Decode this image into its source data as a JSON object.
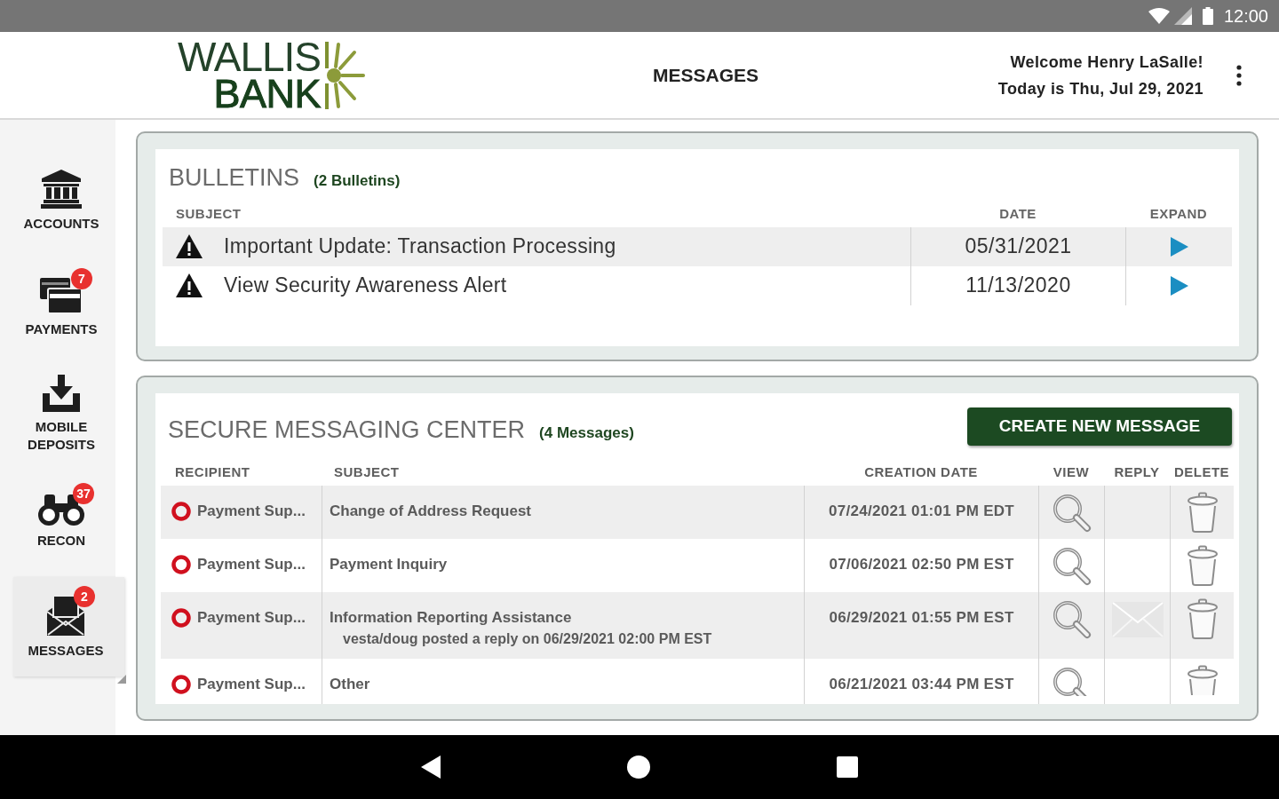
{
  "status_bar": {
    "time": "12:00"
  },
  "header": {
    "logo": [
      "WALLIS",
      "BANK"
    ],
    "title": "MESSAGES",
    "welcome": "Welcome Henry LaSalle!",
    "date": "Today is Thu, Jul 29, 2021"
  },
  "sidebar": {
    "items": [
      {
        "label": "ACCOUNTS",
        "selected": false
      },
      {
        "label": "PAYMENTS",
        "badge": "7",
        "selected": false
      },
      {
        "label": "MOBILE DEPOSITS",
        "selected": false
      },
      {
        "label": "RECON",
        "badge": "37",
        "selected": false
      },
      {
        "label": "MESSAGES",
        "badge": "2",
        "selected": true
      }
    ]
  },
  "bulletins": {
    "title": "BULLETINS",
    "count": "(2 Bulletins)",
    "columns": [
      "SUBJECT",
      "DATE",
      "EXPAND"
    ],
    "rows": [
      {
        "subject": "Important Update: Transaction Processing",
        "date": "05/31/2021"
      },
      {
        "subject": "View Security Awareness Alert",
        "date": "11/13/2020"
      }
    ]
  },
  "messages": {
    "title": "SECURE MESSAGING CENTER",
    "count": "(4 Messages)",
    "create_button": "CREATE NEW MESSAGE",
    "columns": [
      "RECIPIENT",
      "SUBJECT",
      "CREATION DATE",
      "VIEW",
      "REPLY",
      "DELETE"
    ],
    "rows": [
      {
        "recipient": "Payment Sup...",
        "subject": "Change of Address Request",
        "created": "07/24/2021 01:01 PM EDT",
        "reply_available": false
      },
      {
        "recipient": "Payment Sup...",
        "subject": "Payment Inquiry",
        "created": "07/06/2021 02:50 PM EST",
        "reply_available": false
      },
      {
        "recipient": "Payment Sup...",
        "subject": "Information Reporting Assistance",
        "note": "vesta/doug posted a reply on 06/29/2021 02:00 PM EST",
        "created": "06/29/2021 01:55 PM EST",
        "reply_available": true
      },
      {
        "recipient": "Payment Sup...",
        "subject": "Other",
        "created": "06/21/2021 03:44 PM EST",
        "reply_available": false
      }
    ]
  }
}
